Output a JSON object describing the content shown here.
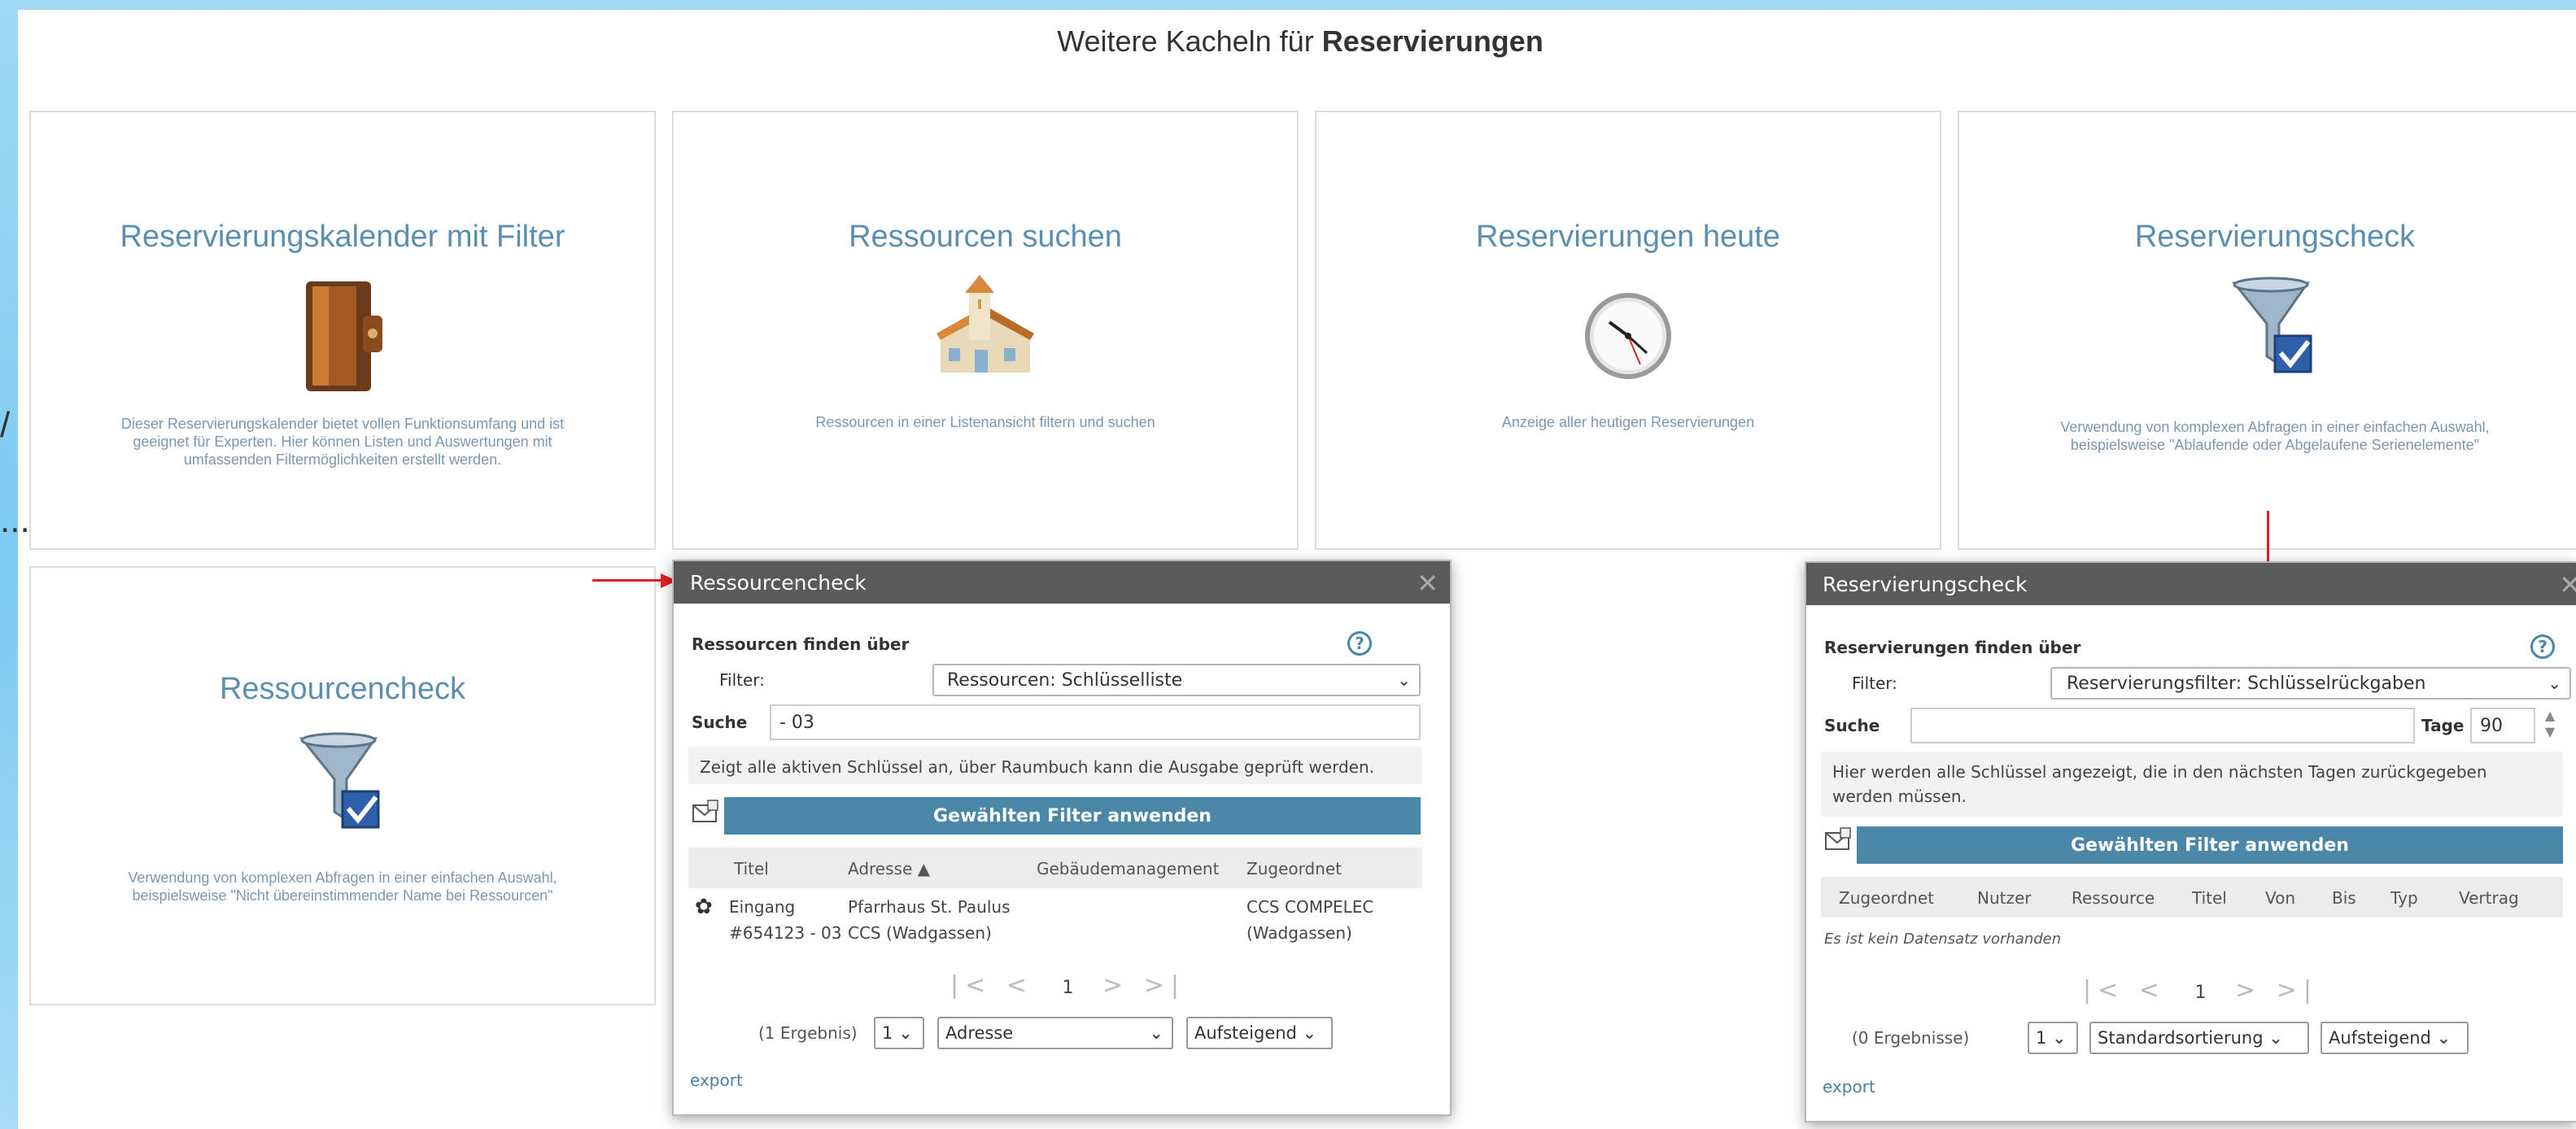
{
  "page": {
    "heading_prefix": "Weitere Kacheln für",
    "heading_bold": "Reservierungen",
    "stray_chars": [
      "/",
      "..."
    ]
  },
  "tiles": [
    {
      "title": "Reservierungskalender mit Filter",
      "icon": "wallet-icon",
      "desc": "Dieser Reservierungskalender bietet vollen Funktionsumfang und ist geeignet für Experten. Hier können Listen und Auswertungen mit umfassenden Filtermöglichkeiten erstellt werden."
    },
    {
      "title": "Ressourcen suchen",
      "icon": "church-icon",
      "desc": "Ressourcen in einer Listenansicht filtern und suchen"
    },
    {
      "title": "Reservierungen heute",
      "icon": "clock-icon",
      "desc": "Anzeige aller heutigen Reservierungen"
    },
    {
      "title": "Reservierungscheck",
      "icon": "funnel-check-icon",
      "desc": "Verwendung von komplexen Abfragen in einer einfachen Auswahl, beispielsweise \"Ablaufende oder Abgelaufene Serienelemente\""
    },
    {
      "title": "Ressourcencheck",
      "icon": "funnel-check-icon",
      "desc": "Verwendung von komplexen Abfragen in einer einfachen Auswahl, beispielsweise \"Nicht übereinstimmender Name bei Ressourcen\""
    }
  ],
  "dialog_ressourcen": {
    "title": "Ressourcencheck",
    "find_label": "Ressourcen finden über",
    "filter_label": "Filter:",
    "filter_value": "Ressourcen: Schlüsselliste",
    "search_label": "Suche",
    "search_value": "- 03",
    "info": "Zeigt alle aktiven Schlüssel an, über Raumbuch kann die Ausgabe geprüft werden.",
    "apply_label": "Gewählten Filter anwenden",
    "columns": [
      "Titel",
      "Adresse ▲",
      "Gebäudemanagement",
      "Zugeordnet"
    ],
    "row": {
      "titel_1": "Eingang",
      "titel_2": "#654123 - 03",
      "adresse_1": "Pfarrhaus St. Paulus",
      "adresse_2": "CCS (Wadgassen)",
      "zugeordnet_1": "CCS COMPELEC",
      "zugeordnet_2": "(Wadgassen)"
    },
    "pager_first": "|<",
    "pager_prev": "<",
    "page": "1",
    "pager_next": ">",
    "pager_last": ">|",
    "results": "(1 Ergebnis)",
    "page_select": "1",
    "sort_field": "Adresse",
    "sort_order": "Aufsteigend",
    "export": "export"
  },
  "dialog_reservierungen": {
    "title": "Reservierungscheck",
    "find_label": "Reservierungen finden über",
    "filter_label": "Filter:",
    "filter_value": "Reservierungsfilter: Schlüsselrückgaben",
    "search_label": "Suche",
    "search_value": "",
    "tage_label": "Tage",
    "tage_value": "90",
    "info": "Hier werden alle Schlüssel angezeigt, die in den nächsten Tagen zurückgegeben werden müssen.",
    "apply_label": "Gewählten Filter anwenden",
    "columns": [
      "Zugeordnet",
      "Nutzer",
      "Ressource",
      "Titel",
      "Von",
      "Bis",
      "Typ",
      "Vertrag"
    ],
    "empty": "Es ist kein Datensatz vorhanden",
    "pager_first": "|<",
    "pager_prev": "<",
    "page": "1",
    "pager_next": ">",
    "pager_last": ">|",
    "results": "(0 Ergebnisse)",
    "page_select": "1",
    "sort_field": "Standardsortierung",
    "sort_order": "Aufsteigend",
    "export": "export"
  },
  "colors": {
    "accent": "#4a86a8",
    "tile_title": "#5b8fb2",
    "header": "#5a5a5a",
    "arrow": "#e02020"
  }
}
